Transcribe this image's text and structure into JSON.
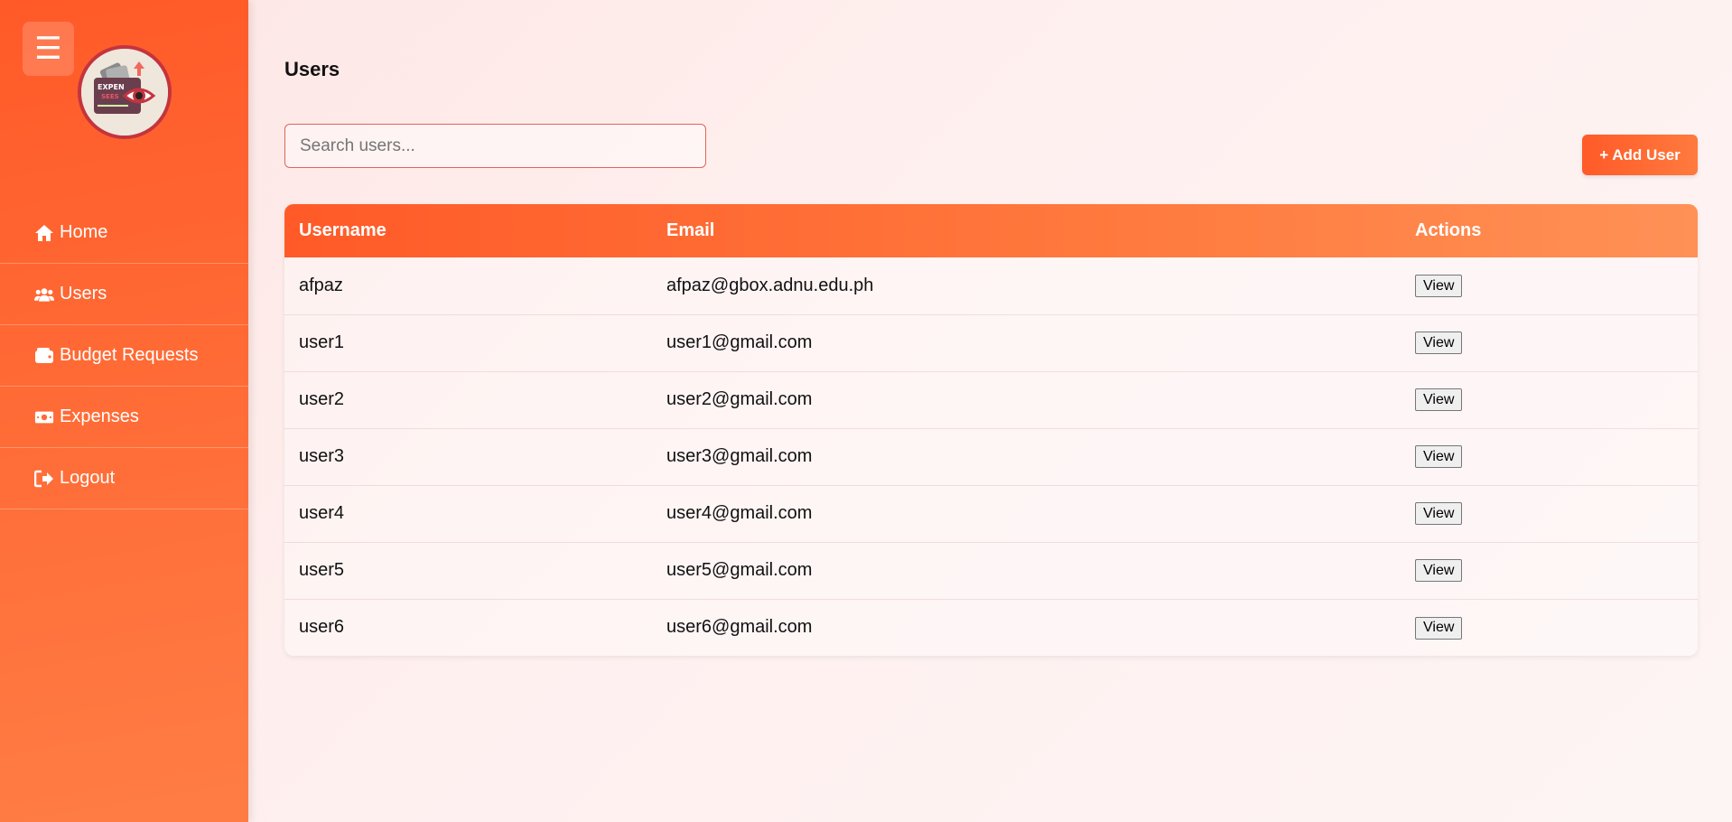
{
  "sidebar": {
    "menu_icon": "hamburger-icon",
    "logo_alt": "Expense Tracker logo",
    "items": [
      {
        "label": "Home",
        "icon": "home-icon"
      },
      {
        "label": "Users",
        "icon": "users-icon"
      },
      {
        "label": "Budget Requests",
        "icon": "wallet-icon"
      },
      {
        "label": "Expenses",
        "icon": "money-bill-icon"
      },
      {
        "label": "Logout",
        "icon": "logout-icon"
      }
    ]
  },
  "colors": {
    "accent": "#ff5a28",
    "accent_light": "#ff7a3e",
    "background": "#fde8e6"
  },
  "main": {
    "title": "Users",
    "search": {
      "placeholder": "Search users...",
      "value": ""
    },
    "add_button": "+ Add User",
    "table": {
      "columns": [
        "Username",
        "Email",
        "Actions"
      ],
      "rows": [
        {
          "username": "afpaz",
          "email": "afpaz@gbox.adnu.edu.ph",
          "action": "View"
        },
        {
          "username": "user1",
          "email": "user1@gmail.com",
          "action": "View"
        },
        {
          "username": "user2",
          "email": "user2@gmail.com",
          "action": "View"
        },
        {
          "username": "user3",
          "email": "user3@gmail.com",
          "action": "View"
        },
        {
          "username": "user4",
          "email": "user4@gmail.com",
          "action": "View"
        },
        {
          "username": "user5",
          "email": "user5@gmail.com",
          "action": "View"
        },
        {
          "username": "user6",
          "email": "user6@gmail.com",
          "action": "View"
        }
      ]
    }
  }
}
